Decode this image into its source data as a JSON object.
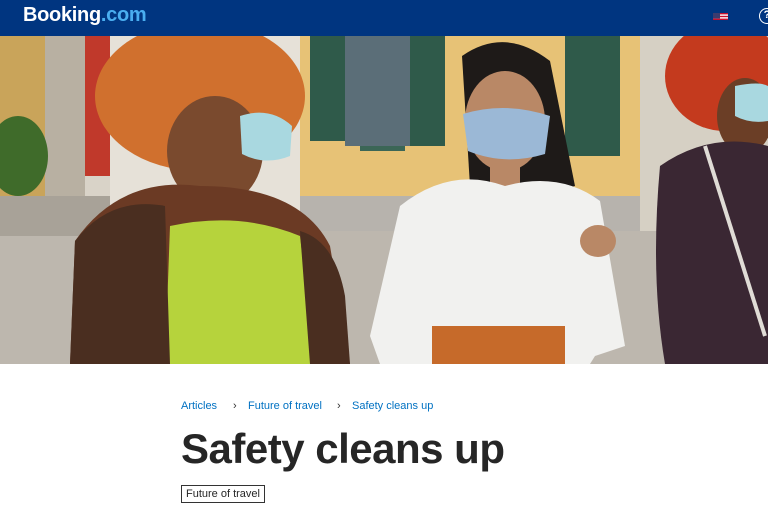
{
  "header": {
    "logo_main": "Booking",
    "logo_suffix": ".com",
    "flag_icon": "us-flag-icon",
    "help_icon": "help-circle-icon",
    "help_glyph": "?",
    "background_color": "#003580"
  },
  "breadcrumb": {
    "items": [
      {
        "label": "Articles"
      },
      {
        "label": "Future of travel"
      },
      {
        "label": "Safety cleans up"
      }
    ],
    "separator": "›"
  },
  "article": {
    "title": "Safety cleans up",
    "tag": "Future of travel"
  }
}
